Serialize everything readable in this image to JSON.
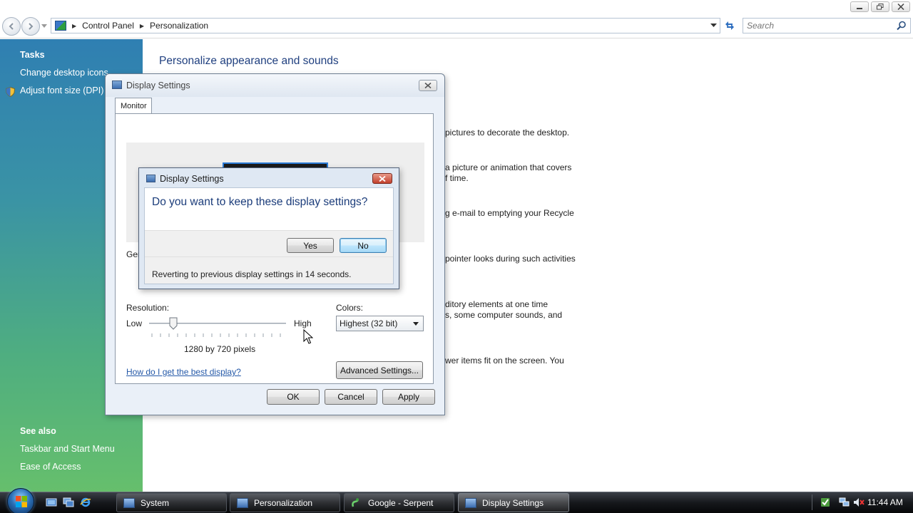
{
  "explorer": {
    "breadcrumb": [
      "Control Panel",
      "Personalization"
    ],
    "search_placeholder": "Search"
  },
  "taskpane": {
    "tasks_header": "Tasks",
    "tasks": [
      "Change desktop icons",
      "Adjust font size (DPI)"
    ],
    "see_also_header": "See also",
    "see_also": [
      "Taskbar and Start Menu",
      "Ease of Access"
    ]
  },
  "main": {
    "title": "Personalize appearance and sounds",
    "fragments": [
      "pictures to decorate the desktop.",
      "a picture or animation that covers",
      "f time.",
      "g e-mail to emptying your Recycle",
      "pointer looks during such activities",
      "ditory elements at one time",
      "s, some computer sounds, and",
      "wer items fit on the screen. You"
    ]
  },
  "display_settings": {
    "title": "Display Settings",
    "tab": "Monitor",
    "generic_label": "Gen",
    "resolution_label": "Resolution:",
    "low": "Low",
    "high": "High",
    "pixels": "1280 by 720 pixels",
    "colors_label": "Colors:",
    "colors_value": "Highest (32 bit)",
    "help_link": "How do I get the best display?",
    "advanced_button": "Advanced Settings...",
    "ok": "OK",
    "cancel": "Cancel",
    "apply": "Apply"
  },
  "confirm_dialog": {
    "title": "Display Settings",
    "question": "Do you want to keep these display settings?",
    "yes": "Yes",
    "no": "No",
    "revert_message": "Reverting to previous display settings in 14 seconds."
  },
  "taskbar": {
    "buttons": [
      "System",
      "Personalization",
      "Google - Serpent",
      "Display Settings"
    ],
    "clock": "11:44 AM"
  }
}
